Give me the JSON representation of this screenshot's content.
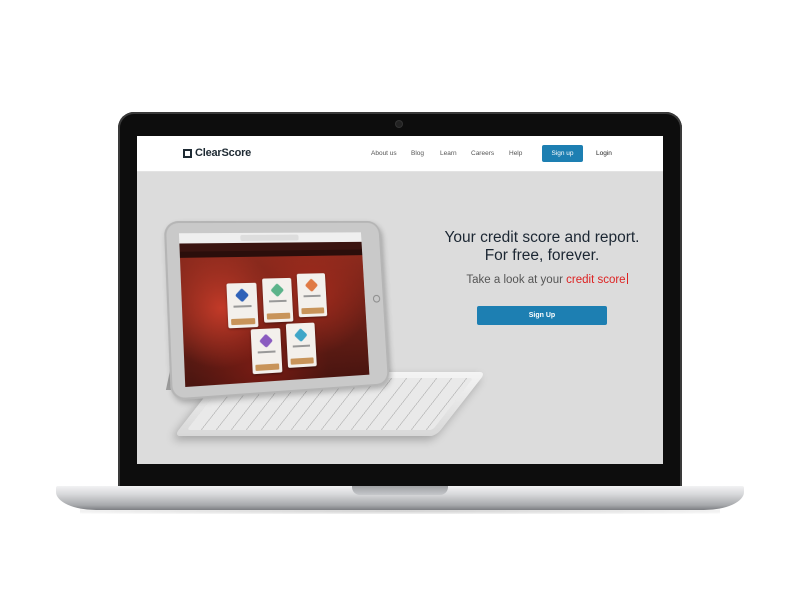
{
  "site": {
    "brand": "ClearScore",
    "nav": {
      "links": [
        "About us",
        "Blog",
        "Learn",
        "Careers",
        "Help"
      ],
      "signup_label": "Sign up",
      "login_label": "Login"
    },
    "hero": {
      "title_line1": "Your credit score and report.",
      "title_line2": "For free, forever.",
      "subtitle_prefix": "Take a look at your",
      "subtitle_highlight": "credit score",
      "cta_label": "Sign Up"
    }
  },
  "colors": {
    "accent_blue": "#1d7fb2",
    "highlight_red": "#dd2222",
    "hero_background": "#dcdcdc",
    "laptop_bezel": "#0d0d0d"
  },
  "icons": [
    "clearscore-logo-icon"
  ]
}
